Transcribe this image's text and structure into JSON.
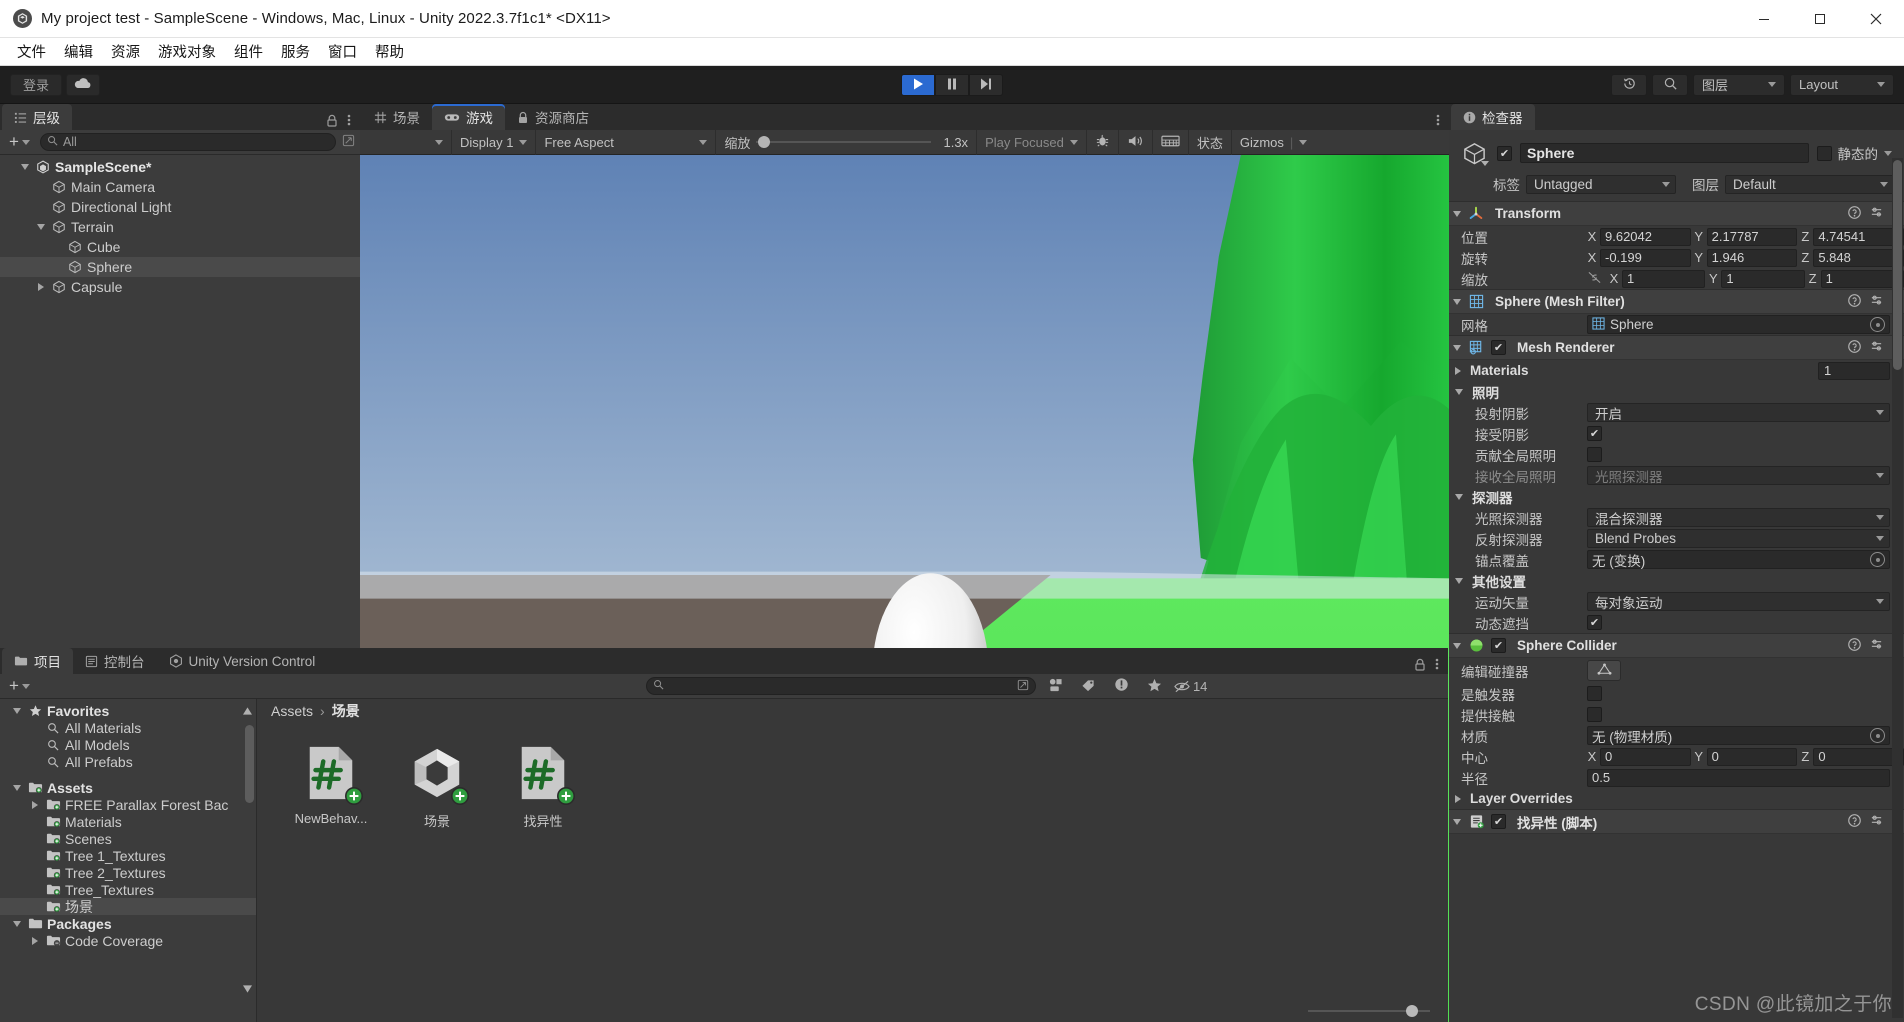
{
  "window": {
    "title": "My project test - SampleScene - Windows, Mac, Linux - Unity 2022.3.7f1c1* <DX11>",
    "minimize": "–",
    "maximize": "□",
    "close": "✕"
  },
  "menu": [
    "文件",
    "编辑",
    "资源",
    "游戏对象",
    "组件",
    "服务",
    "窗口",
    "帮助"
  ],
  "toolbar": {
    "login_label": "登录",
    "cloud_icon": "cloud-icon",
    "play_icon": "play-icon",
    "pause_icon": "pause-icon",
    "step_icon": "step-icon",
    "history_icon": "history-icon",
    "search_icon": "search-icon",
    "layers_label": "图层",
    "layout_label": "Layout"
  },
  "hierarchy": {
    "tab_label": "层级",
    "search_placeholder": "All",
    "items": [
      {
        "label": "SampleScene*",
        "depth": 0,
        "arrow": "open",
        "icon": "unity-scene-icon",
        "selected": false,
        "root": true
      },
      {
        "label": "Main Camera",
        "depth": 1,
        "arrow": "none",
        "icon": "gameobject-icon",
        "selected": false,
        "root": false
      },
      {
        "label": "Directional Light",
        "depth": 1,
        "arrow": "none",
        "icon": "gameobject-icon",
        "selected": false,
        "root": false
      },
      {
        "label": "Terrain",
        "depth": 1,
        "arrow": "open",
        "icon": "gameobject-icon",
        "selected": false,
        "root": false
      },
      {
        "label": "Cube",
        "depth": 2,
        "arrow": "none",
        "icon": "gameobject-icon",
        "selected": false,
        "root": false
      },
      {
        "label": "Sphere",
        "depth": 2,
        "arrow": "none",
        "icon": "gameobject-icon",
        "selected": true,
        "root": false
      },
      {
        "label": "Capsule",
        "depth": 1,
        "arrow": "closed",
        "icon": "gameobject-icon",
        "selected": false,
        "root": false
      }
    ]
  },
  "center": {
    "tabs": [
      {
        "label": "场景",
        "icon": "scene-grid-icon",
        "active": false
      },
      {
        "label": "游戏",
        "icon": "gamepad-icon",
        "active": true
      },
      {
        "label": "资源商店",
        "icon": "store-lock-icon",
        "active": false
      }
    ],
    "gameview_toolbar": {
      "display": "Display 1",
      "aspect": "Free Aspect",
      "scale_label": "缩放",
      "scale_value": "1.3x",
      "play_mode": "Play Focused",
      "stats_label": "状态",
      "gizmos_label": "Gizmos",
      "mute_icon": "audio-icon",
      "bug_icon": "bug-icon",
      "stats_icon": "frame-icon"
    }
  },
  "project": {
    "tabs": [
      {
        "label": "项目",
        "icon": "folder-icon",
        "active": true
      },
      {
        "label": "控制台",
        "icon": "console-icon",
        "active": false
      },
      {
        "label": "Unity Version Control",
        "icon": "version-control-icon",
        "active": false
      }
    ],
    "search_placeholder": "",
    "filter_icons": [
      "asset-type-icon",
      "label-icon",
      "warning-icon",
      "favorite-icon"
    ],
    "badge_count": "14",
    "tree": [
      {
        "label": "Favorites",
        "depth": 0,
        "arrow": "open",
        "icon": "star-icon",
        "bold": true,
        "selected": false
      },
      {
        "label": "All Materials",
        "depth": 1,
        "arrow": "none",
        "icon": "search-small-icon",
        "bold": false,
        "selected": false
      },
      {
        "label": "All Models",
        "depth": 1,
        "arrow": "none",
        "icon": "search-small-icon",
        "bold": false,
        "selected": false
      },
      {
        "label": "All Prefabs",
        "depth": 1,
        "arrow": "none",
        "icon": "search-small-icon",
        "bold": false,
        "selected": false
      },
      {
        "label": "",
        "depth": 0,
        "arrow": "none",
        "icon": "none",
        "bold": false,
        "selected": false
      },
      {
        "label": "Assets",
        "depth": 0,
        "arrow": "open",
        "icon": "folder-plus-icon",
        "bold": true,
        "selected": false
      },
      {
        "label": "FREE Parallax Forest Bac",
        "depth": 1,
        "arrow": "closed",
        "icon": "folder-plus-icon",
        "bold": false,
        "selected": false
      },
      {
        "label": "Materials",
        "depth": 1,
        "arrow": "none",
        "icon": "folder-plus-icon",
        "bold": false,
        "selected": false
      },
      {
        "label": "Scenes",
        "depth": 1,
        "arrow": "none",
        "icon": "folder-plus-icon",
        "bold": false,
        "selected": false
      },
      {
        "label": "Tree 1_Textures",
        "depth": 1,
        "arrow": "none",
        "icon": "folder-plus-icon",
        "bold": false,
        "selected": false
      },
      {
        "label": "Tree 2_Textures",
        "depth": 1,
        "arrow": "none",
        "icon": "folder-plus-icon",
        "bold": false,
        "selected": false
      },
      {
        "label": "Tree_Textures",
        "depth": 1,
        "arrow": "none",
        "icon": "folder-plus-icon",
        "bold": false,
        "selected": false
      },
      {
        "label": "场景",
        "depth": 1,
        "arrow": "none",
        "icon": "folder-plus-icon",
        "bold": false,
        "selected": true
      },
      {
        "label": "Packages",
        "depth": 0,
        "arrow": "open",
        "icon": "folder-icon",
        "bold": true,
        "selected": false
      },
      {
        "label": "Code Coverage",
        "depth": 1,
        "arrow": "closed",
        "icon": "folder-minus-icon",
        "bold": false,
        "selected": false
      }
    ],
    "breadcrumb": [
      "Assets",
      "场景"
    ],
    "assets": [
      {
        "name": "NewBehav...",
        "type": "csharp-script-icon"
      },
      {
        "name": "场景",
        "type": "unity-scene-asset-icon"
      },
      {
        "name": "找异性",
        "type": "csharp-script-icon"
      }
    ]
  },
  "inspector": {
    "tab_label": "检查器",
    "object": {
      "enabled": true,
      "name": "Sphere",
      "static_label": "静态的",
      "static_checked": false,
      "tag_label": "标签",
      "tag_value": "Untagged",
      "layer_label": "图层",
      "layer_value": "Default"
    },
    "components": [
      {
        "title": "Transform",
        "icon": "transform-icon",
        "has_toggle": false,
        "rows": [
          {
            "kind": "vector3",
            "label": "位置",
            "x": "9.62042",
            "y": "2.17787",
            "z": "4.74541"
          },
          {
            "kind": "vector3",
            "label": "旋转",
            "x": "-0.199",
            "y": "1.946",
            "z": "5.848"
          },
          {
            "kind": "vector3",
            "label": "缩放",
            "x": "1",
            "y": "1",
            "z": "1",
            "link_icon": "link-broken-icon"
          }
        ]
      },
      {
        "title": "Sphere (Mesh Filter)",
        "icon": "mesh-filter-icon",
        "has_toggle": false,
        "rows": [
          {
            "kind": "object",
            "label": "网格",
            "value": "Sphere",
            "value_icon": "mesh-icon"
          }
        ]
      },
      {
        "title": "Mesh Renderer",
        "icon": "mesh-renderer-icon",
        "has_toggle": true,
        "toggle_checked": true,
        "rows": [
          {
            "kind": "foldout-count",
            "label": "Materials",
            "arrow": "closed",
            "value": "1"
          },
          {
            "kind": "foldout",
            "label": "照明",
            "arrow": "open"
          },
          {
            "kind": "dropdown",
            "label": "投射阴影",
            "value": "开启",
            "indent": true
          },
          {
            "kind": "checkbox",
            "label": "接受阴影",
            "checked": true,
            "indent": true
          },
          {
            "kind": "checkbox",
            "label": "贡献全局照明",
            "checked": false,
            "indent": true
          },
          {
            "kind": "dropdown",
            "label": "接收全局照明",
            "value": "光照探测器",
            "indent": true,
            "disabled": true
          },
          {
            "kind": "foldout",
            "label": "探测器",
            "arrow": "open"
          },
          {
            "kind": "dropdown",
            "label": "光照探测器",
            "value": "混合探测器",
            "indent": true
          },
          {
            "kind": "dropdown",
            "label": "反射探测器",
            "value": "Blend Probes",
            "indent": true
          },
          {
            "kind": "object",
            "label": "锚点覆盖",
            "value": "无 (变换)",
            "indent": true
          },
          {
            "kind": "foldout",
            "label": "其他设置",
            "arrow": "open"
          },
          {
            "kind": "dropdown",
            "label": "运动矢量",
            "value": "每对象运动",
            "indent": true
          },
          {
            "kind": "checkbox",
            "label": "动态遮挡",
            "checked": true,
            "indent": true
          }
        ]
      },
      {
        "title": "Sphere Collider",
        "icon": "collider-icon",
        "has_toggle": true,
        "toggle_checked": true,
        "rows": [
          {
            "kind": "editbutton",
            "label": "编辑碰撞器",
            "icon": "edit-collider-icon"
          },
          {
            "kind": "checkbox",
            "label": "是触发器",
            "checked": false
          },
          {
            "kind": "checkbox",
            "label": "提供接触",
            "checked": false
          },
          {
            "kind": "object",
            "label": "材质",
            "value": "无 (物理材质)"
          },
          {
            "kind": "vector3",
            "label": "中心",
            "x": "0",
            "y": "0",
            "z": "0"
          },
          {
            "kind": "text",
            "label": "半径",
            "value": "0.5"
          },
          {
            "kind": "foldout",
            "label": "Layer Overrides",
            "arrow": "closed"
          }
        ]
      },
      {
        "title": "找异性 (脚本)",
        "icon": "script-icon",
        "has_toggle": true,
        "toggle_checked": true,
        "clipped": true,
        "rows": []
      }
    ]
  },
  "watermark": "CSDN @此镜加之于你"
}
